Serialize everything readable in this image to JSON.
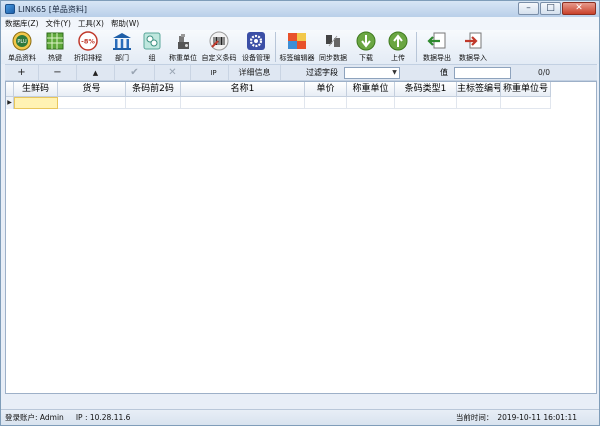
{
  "window": {
    "title": "LINK65 [单品资料]"
  },
  "window_buttons": {
    "minimize": "–",
    "maximize": "□",
    "close": "✕"
  },
  "menu": [
    "数据库(Z)",
    "文件(Y)",
    "工具(X)",
    "帮助(W)"
  ],
  "toolbar": [
    {
      "label": "单品资料",
      "icon": "plu-icon"
    },
    {
      "label": "热键",
      "icon": "hotkey-grid-icon"
    },
    {
      "label": "折扣排程",
      "icon": "discount-icon",
      "icon_text": "-8%"
    },
    {
      "label": "部门",
      "icon": "department-building-icon"
    },
    {
      "label": "组",
      "icon": "group-icon"
    },
    {
      "label": "称重单位",
      "icon": "weight-unit-icon"
    },
    {
      "label": "自定义条码",
      "icon": "barcode-icon"
    },
    {
      "label": "设备管理",
      "icon": "device-gear-icon"
    },
    {
      "label": "标签编辑器",
      "icon": "label-editor-icon"
    },
    {
      "label": "同步数据",
      "icon": "sync-icon"
    },
    {
      "label": "下载",
      "icon": "download-arrow-icon"
    },
    {
      "label": "上传",
      "icon": "upload-arrow-icon"
    },
    {
      "label": "数据导出",
      "icon": "export-icon"
    },
    {
      "label": "数据导入",
      "icon": "import-icon"
    }
  ],
  "nav": {
    "add": "+",
    "remove": "−",
    "up": "▲",
    "confirm": "✔",
    "cancel": "✕",
    "ip_button": "IP",
    "detail_button": "详细信息",
    "filter_label": "过滤字段",
    "filter_value": "",
    "value_label": "值",
    "value": "",
    "counter": "0/0"
  },
  "grid": {
    "columns": [
      "生鲜码",
      "货号",
      "条码前2码",
      "名称1",
      "单价",
      "称重单位",
      "条码类型1",
      "主标签编号",
      "称重单位号"
    ],
    "row_indicator": "▶"
  },
  "status": {
    "account": "登录账户: Admin",
    "ip": "IP : 10.28.11.6",
    "time_label": "当前时间：",
    "time": "2019-10-11 16:01:11"
  },
  "colors": {
    "titlebar": "#c6d9ef",
    "selected_cell": "#fff2b3",
    "green_button": "#6aa642"
  }
}
